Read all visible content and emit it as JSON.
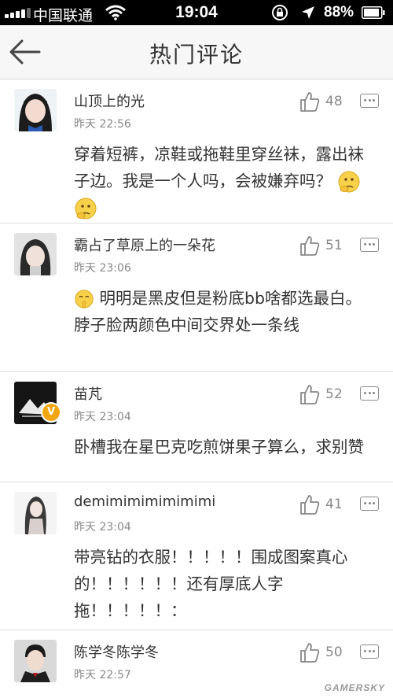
{
  "status_bar": {
    "carrier": "中国联通",
    "time": "19:04",
    "battery_percent": "88%",
    "icons": [
      "signal-icon",
      "wifi-icon",
      "rotation-lock-icon",
      "location-icon",
      "battery-icon"
    ]
  },
  "nav": {
    "back_icon": "back-arrow-icon",
    "title": "热门评论"
  },
  "comments": [
    {
      "username": "山顶上的光",
      "time": "昨天 22:56",
      "likes": "48",
      "text": "穿着短裤，凉鞋或拖鞋里穿丝袜，露出袜子边。我是一个人吗，会被嫌弃吗？",
      "emoji_suffix": [
        "thinking-face-emoji",
        "thinking-face-emoji"
      ]
    },
    {
      "username": "霸占了草原上的一朵花",
      "time": "昨天 23:06",
      "likes": "51",
      "emoji_prefix": [
        "shushing-face-emoji"
      ],
      "text": "明明是黑皮但是粉底bb啥都选最白。脖子脸两颜色中间交界处一条线"
    },
    {
      "username": "苗芃",
      "time": "昨天 23:04",
      "likes": "52",
      "verified_badge": "V",
      "text": "卧槽我在星巴克吃煎饼果子算么，求别赞"
    },
    {
      "username": "demimimimimimimi",
      "time": "昨天 23:04",
      "likes": "41",
      "text": "带亮钻的衣服！！！！！围成图案真心的！！！！！！还有厚底人字拖！！！！！："
    },
    {
      "username": "陈学冬陈学冬",
      "time": "昨天 22:57",
      "likes": "50",
      "text": ""
    }
  ],
  "watermark": "GAMERSKY",
  "colors": {
    "background": "#ffffff",
    "nav_bg": "#f7f7f7",
    "text": "#333333",
    "meta": "#888888",
    "badge": "#f2a611"
  }
}
